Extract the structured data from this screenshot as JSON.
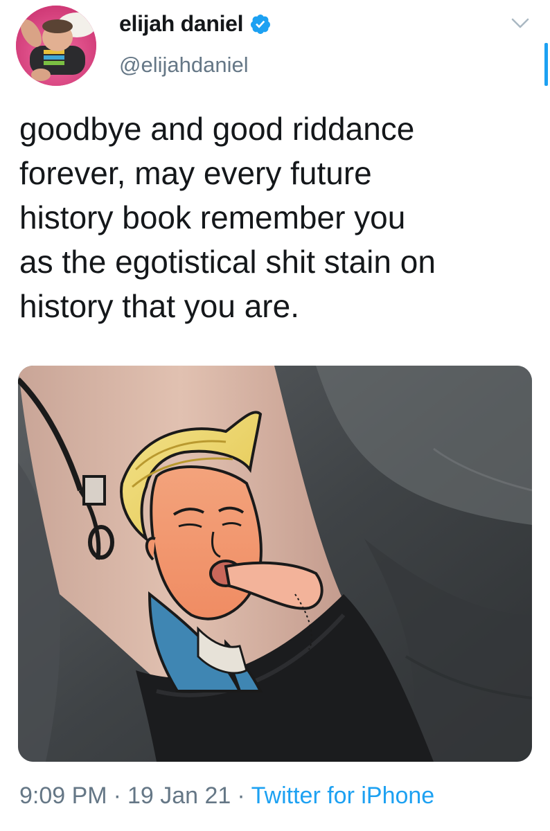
{
  "tweet": {
    "author": {
      "display_name": "elijah daniel",
      "handle": "@elijahdaniel",
      "verified": true
    },
    "text": "goodbye and good riddance\nforever, may every future\nhistory book remember you\nas the egotistical shit stain on\nhistory that you are.",
    "time": "9:09 PM",
    "date": "19 Jan 21",
    "source": "Twitter for iPhone",
    "separator": "·",
    "media": {
      "kind": "photo"
    }
  },
  "icons": {
    "verified": "verified-badge-icon",
    "menu": "chevron-down-icon"
  },
  "colors": {
    "text": "#14171a",
    "secondary": "#657786",
    "accent": "#1da1f2"
  }
}
